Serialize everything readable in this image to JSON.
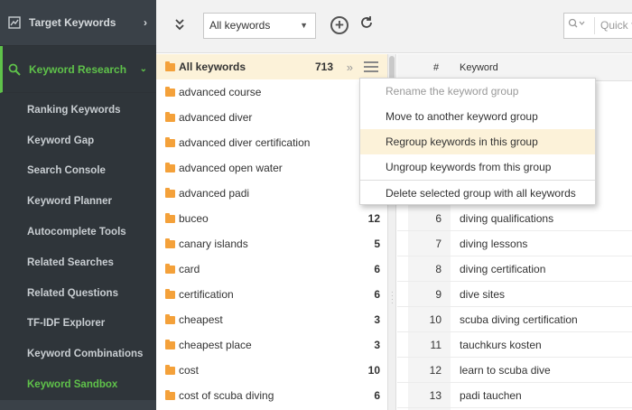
{
  "sidebar": {
    "target_keywords": "Target Keywords",
    "keyword_research": "Keyword Research",
    "items": [
      {
        "label": "Ranking Keywords"
      },
      {
        "label": "Keyword Gap"
      },
      {
        "label": "Search Console"
      },
      {
        "label": "Keyword Planner"
      },
      {
        "label": "Autocomplete Tools"
      },
      {
        "label": "Related Searches"
      },
      {
        "label": "Related Questions"
      },
      {
        "label": "TF-IDF Explorer"
      },
      {
        "label": "Keyword Combinations"
      },
      {
        "label": "Keyword Sandbox"
      }
    ],
    "active_item": "Keyword Sandbox",
    "accent_color": "#5fc24a"
  },
  "toolbar": {
    "filter_value": "All keywords",
    "search_placeholder": "Quick f"
  },
  "groups": {
    "all_label": "All keywords",
    "all_count": "713",
    "rows": [
      {
        "name": "advanced course",
        "count": ""
      },
      {
        "name": "advanced diver",
        "count": ""
      },
      {
        "name": "advanced diver certification",
        "count": ""
      },
      {
        "name": "advanced open water",
        "count": ""
      },
      {
        "name": "advanced padi",
        "count": ""
      },
      {
        "name": "buceo",
        "count": "12"
      },
      {
        "name": "canary islands",
        "count": "5"
      },
      {
        "name": "card",
        "count": "6"
      },
      {
        "name": "certification",
        "count": "6"
      },
      {
        "name": "cheapest",
        "count": "3"
      },
      {
        "name": "cheapest place",
        "count": "3"
      },
      {
        "name": "cost",
        "count": "10"
      },
      {
        "name": "cost of scuba diving",
        "count": "6"
      }
    ]
  },
  "keywords": {
    "col_num": "#",
    "col_keyword": "Keyword",
    "rows": [
      {
        "n": "6",
        "k": "diving qualifications"
      },
      {
        "n": "7",
        "k": "diving lessons"
      },
      {
        "n": "8",
        "k": "diving certification"
      },
      {
        "n": "9",
        "k": "dive sites"
      },
      {
        "n": "10",
        "k": "scuba diving certification"
      },
      {
        "n": "11",
        "k": "tauchkurs kosten"
      },
      {
        "n": "12",
        "k": "learn to scuba dive"
      },
      {
        "n": "13",
        "k": "padi tauchen"
      }
    ]
  },
  "context_menu": {
    "items": [
      {
        "label": "Rename the keyword group",
        "disabled": true
      },
      {
        "label": "Move to another keyword group"
      },
      {
        "label": "Regroup keywords in this group",
        "highlighted": true
      },
      {
        "label": "Ungroup keywords from this group"
      },
      {
        "label": "Delete selected group with all keywords"
      }
    ]
  }
}
